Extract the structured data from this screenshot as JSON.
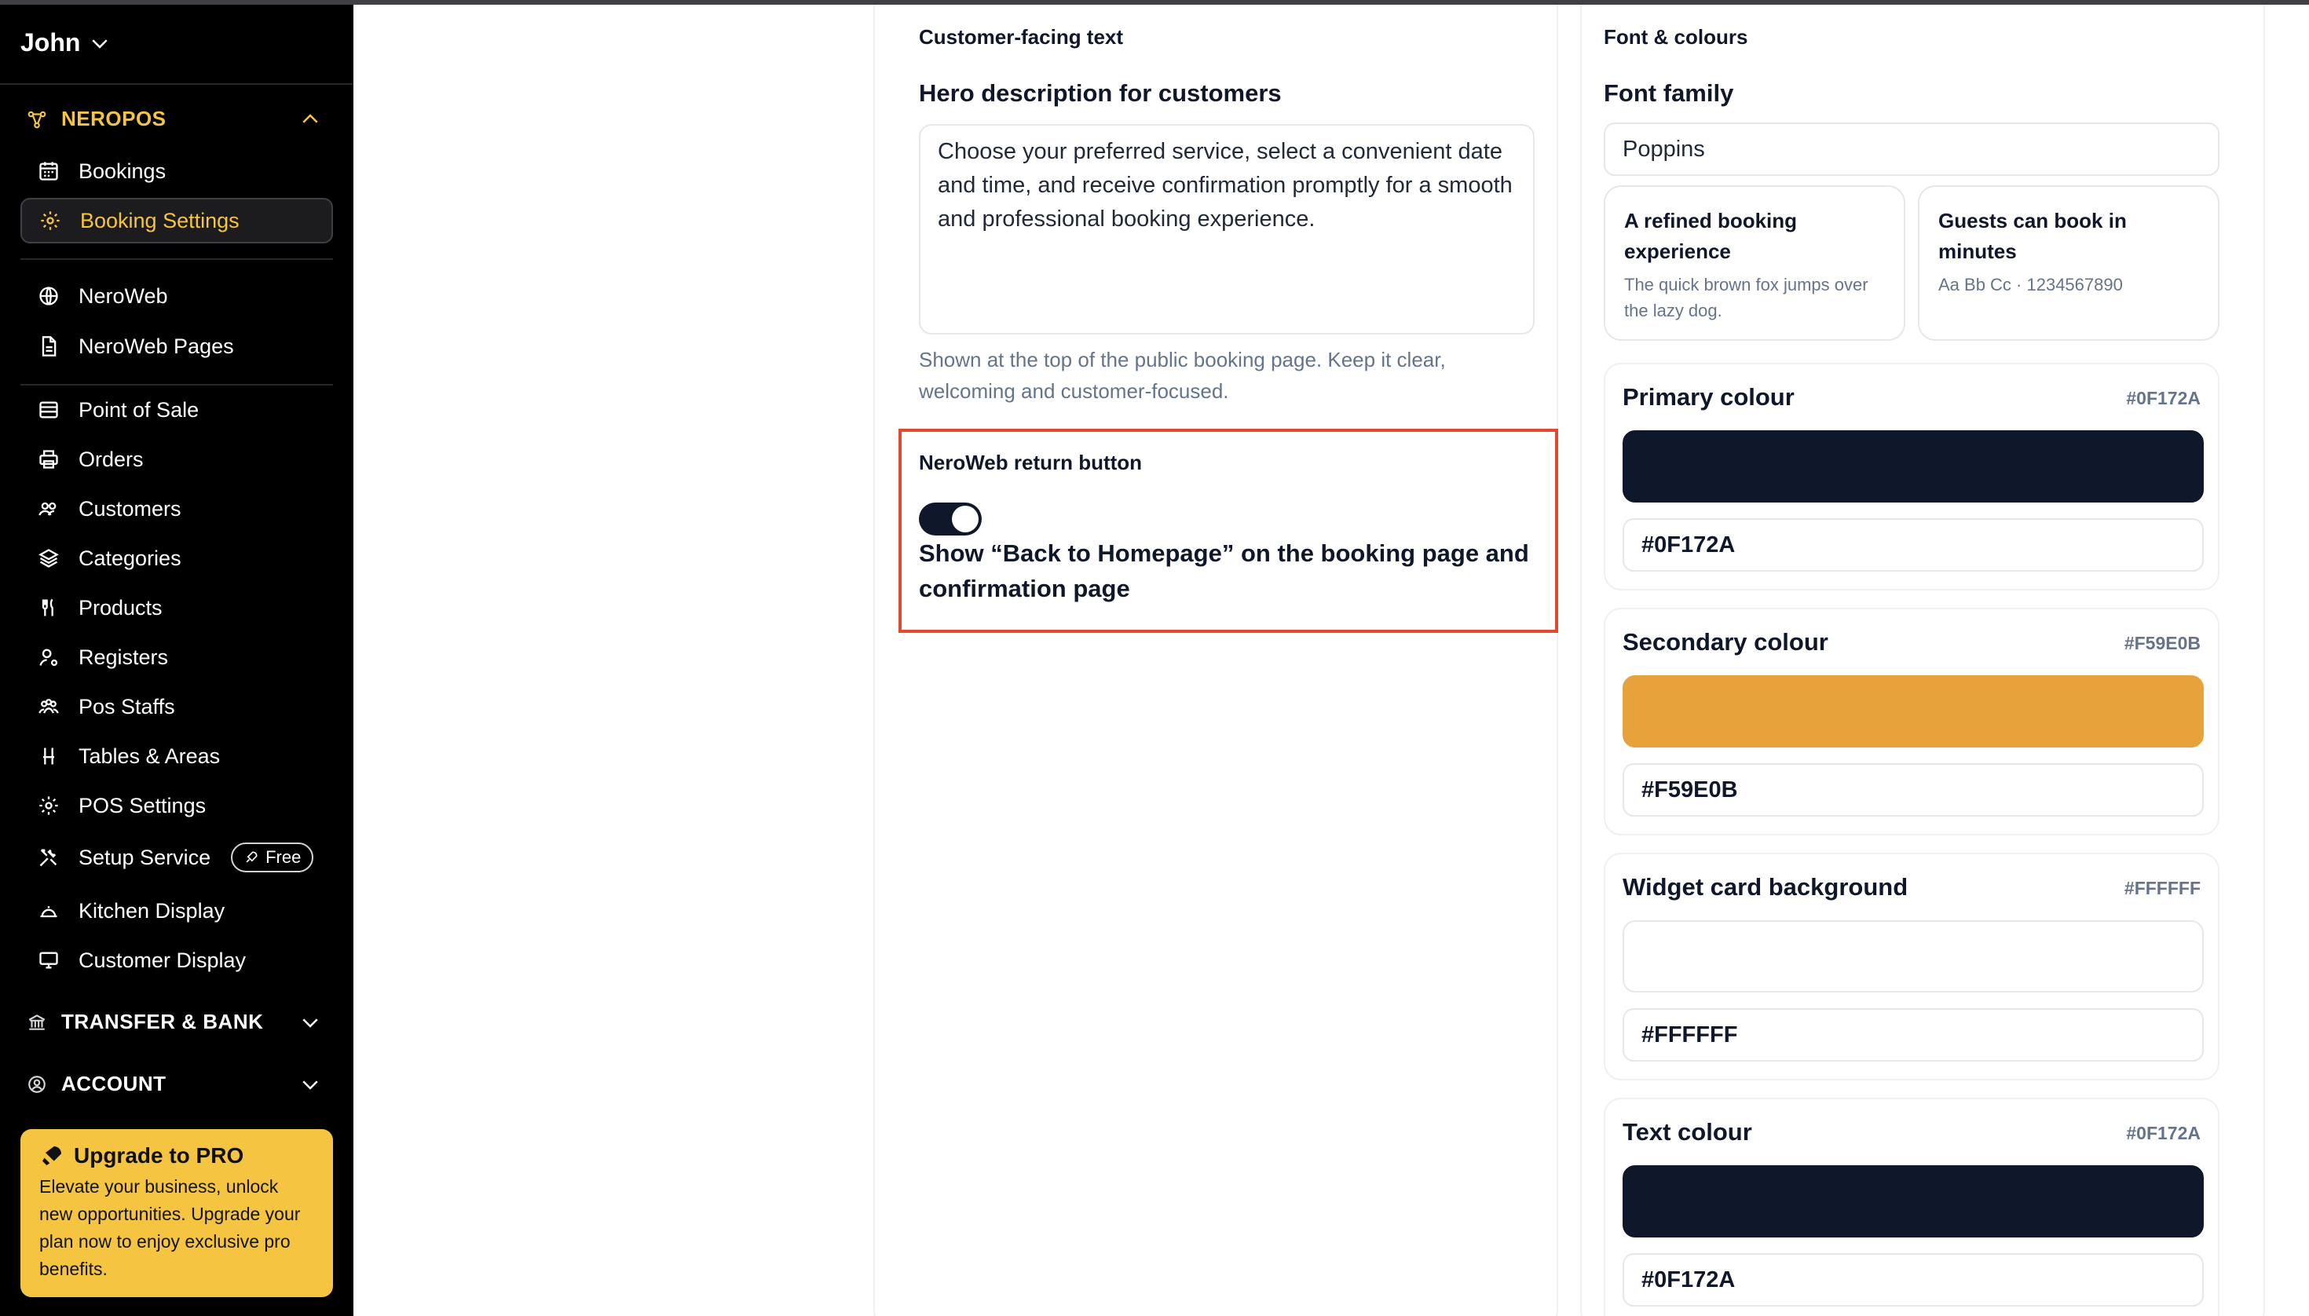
{
  "sidebar": {
    "user_name": "John",
    "brand_section": "NEROPOS",
    "items": [
      {
        "label": "Bookings",
        "icon": "calendar-icon"
      },
      {
        "label": "Booking Settings",
        "icon": "gear-icon"
      },
      {
        "label": "NeroWeb",
        "icon": "globe-icon"
      },
      {
        "label": "NeroWeb Pages",
        "icon": "file-icon"
      },
      {
        "label": "Point of Sale",
        "icon": "pos-icon"
      },
      {
        "label": "Orders",
        "icon": "printer-icon"
      },
      {
        "label": "Customers",
        "icon": "users-icon"
      },
      {
        "label": "Categories",
        "icon": "layers-icon"
      },
      {
        "label": "Products",
        "icon": "utensils-icon"
      },
      {
        "label": "Registers",
        "icon": "user-cog-icon"
      },
      {
        "label": "Pos Staffs",
        "icon": "staff-icon"
      },
      {
        "label": "Tables & Areas",
        "icon": "chair-icon"
      },
      {
        "label": "POS Settings",
        "icon": "gear-icon"
      },
      {
        "label": "Setup Service",
        "icon": "tools-icon",
        "badge": "Free"
      },
      {
        "label": "Kitchen Display",
        "icon": "cloche-icon"
      },
      {
        "label": "Customer Display",
        "icon": "monitor-icon"
      }
    ],
    "transfer_section": "TRANSFER & BANK",
    "account_section": "ACCOUNT",
    "upgrade": {
      "title": "Upgrade to PRO",
      "description": "Elevate your business, unlock new opportunities. Upgrade your plan now to enjoy exclusive pro benefits."
    }
  },
  "customer_text": {
    "section_title": "Customer-facing text",
    "hero_label": "Hero description for customers",
    "hero_value": "Choose your preferred service, select a convenient date and time, and receive confirmation promptly for a smooth and professional booking experience.",
    "hero_help": "Shown at the top of the public booking page. Keep it clear, welcoming and customer-focused.",
    "return_button_title": "NeroWeb return button",
    "return_toggle_on": true,
    "return_toggle_label": "Show “Back to Homepage” on the booking page and confirmation page"
  },
  "font_colours": {
    "section_title": "Font & colours",
    "font_family_label": "Font family",
    "font_family_value": "Poppins",
    "previews": [
      {
        "heading": "A refined booking experience",
        "body": "The quick brown fox jumps over the lazy dog."
      },
      {
        "heading": "Guests can book in minutes",
        "body": "Aa Bb Cc · 1234567890"
      }
    ],
    "colours": [
      {
        "name": "Primary colour",
        "hex": "#0F172A",
        "value": "#0F172A",
        "swatch": "#0f172a"
      },
      {
        "name": "Secondary colour",
        "hex": "#F59E0B",
        "value": "#F59E0B",
        "swatch": "#e8a23b"
      },
      {
        "name": "Widget card background",
        "hex": "#FFFFFF",
        "value": "#FFFFFF",
        "swatch": "#ffffff"
      },
      {
        "name": "Text colour",
        "hex": "#0F172A",
        "value": "#0F172A",
        "swatch": "#0f172a"
      }
    ]
  },
  "colors": {
    "brand_yellow": "#f5c542",
    "highlight_red": "#e24a2f"
  }
}
